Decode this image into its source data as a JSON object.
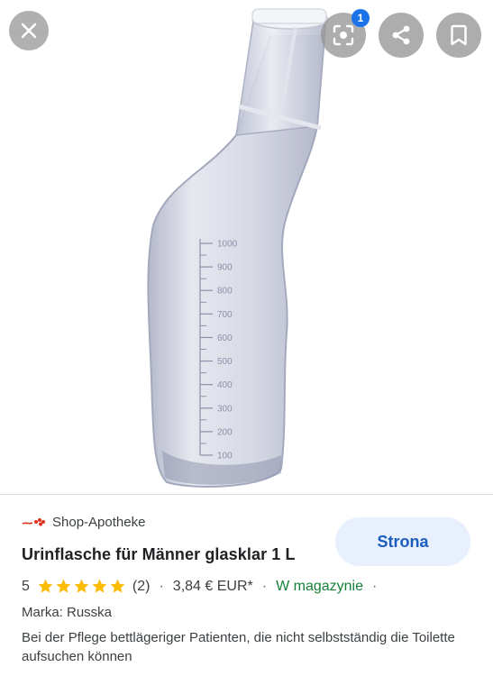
{
  "viewer": {
    "lens_badge": "1",
    "icons": {
      "close": "close-icon",
      "lens": "lens-icon",
      "share": "share-icon",
      "bookmark": "bookmark-icon"
    }
  },
  "product_image": {
    "scale_marks": [
      "1000",
      "900",
      "800",
      "700",
      "600",
      "500",
      "400",
      "300",
      "200",
      "100"
    ]
  },
  "result": {
    "source": "Shop-Apotheke",
    "title": "Urinflasche für Männer glasklar 1 L",
    "visit_label": "Strona",
    "rating": "5",
    "rating_value": 5,
    "review_count": "(2)",
    "separator": "·",
    "price": "3,84 € EUR*",
    "availability": "W magazynie",
    "brand_label": "Marka: Russka",
    "description": "Bei der Pflege bettlägeriger Patienten, die nicht selbstständig die Toilette aufsuchen können"
  },
  "colors": {
    "accent": "#1a73e8",
    "button_bg": "#e8f0fe",
    "button_text": "#1a5dbd",
    "stars": "#fbbc04",
    "stock": "#188038",
    "source_logo": "#e0301e"
  }
}
